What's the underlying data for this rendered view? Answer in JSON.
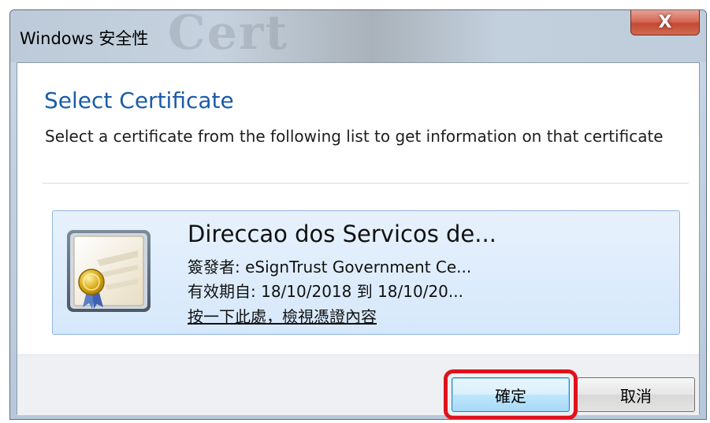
{
  "window": {
    "title": "Windows 安全性",
    "watermark": "Cert",
    "close_label": "X"
  },
  "dialog": {
    "heading": "Select Certificate",
    "description": "Select a certificate from the following list to get information on that certificate"
  },
  "certificate": {
    "name": "Direccao dos Servicos de...",
    "issuer": "簽發者: eSignTrust Government Ce...",
    "validity": "有效期自: 18/10/2018 到 18/10/20...",
    "view_link": "按一下此處，檢視憑證內容",
    "icon": "certificate-icon"
  },
  "buttons": {
    "ok_label": "確定",
    "cancel_label": "取消"
  },
  "colors": {
    "heading": "#1a5ca8",
    "highlight": "#e0111b",
    "tile_background": "#dbeafb"
  }
}
